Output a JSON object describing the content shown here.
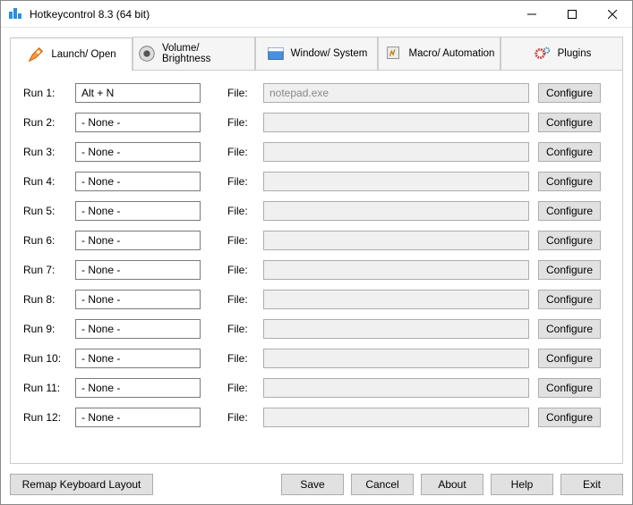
{
  "window": {
    "title": "Hotkeycontrol 8.3 (64 bit)"
  },
  "tabs": [
    {
      "label": "Launch/ Open",
      "active": true
    },
    {
      "label": "Volume/ Brightness",
      "active": false
    },
    {
      "label": "Window/ System",
      "active": false
    },
    {
      "label": "Macro/ Automation",
      "active": false
    },
    {
      "label": "Plugins",
      "active": false
    }
  ],
  "rows": [
    {
      "label": "Run 1:",
      "hotkey": "Alt + N",
      "fileLabel": "File:",
      "file": "notepad.exe",
      "cfg": "Configure"
    },
    {
      "label": "Run 2:",
      "hotkey": "- None -",
      "fileLabel": "File:",
      "file": "",
      "cfg": "Configure"
    },
    {
      "label": "Run 3:",
      "hotkey": "- None -",
      "fileLabel": "File:",
      "file": "",
      "cfg": "Configure"
    },
    {
      "label": "Run 4:",
      "hotkey": "- None -",
      "fileLabel": "File:",
      "file": "",
      "cfg": "Configure"
    },
    {
      "label": "Run 5:",
      "hotkey": "- None -",
      "fileLabel": "File:",
      "file": "",
      "cfg": "Configure"
    },
    {
      "label": "Run 6:",
      "hotkey": "- None -",
      "fileLabel": "File:",
      "file": "",
      "cfg": "Configure"
    },
    {
      "label": "Run 7:",
      "hotkey": "- None -",
      "fileLabel": "File:",
      "file": "",
      "cfg": "Configure"
    },
    {
      "label": "Run 8:",
      "hotkey": "- None -",
      "fileLabel": "File:",
      "file": "",
      "cfg": "Configure"
    },
    {
      "label": "Run 9:",
      "hotkey": "- None -",
      "fileLabel": "File:",
      "file": "",
      "cfg": "Configure"
    },
    {
      "label": "Run 10:",
      "hotkey": "- None -",
      "fileLabel": "File:",
      "file": "",
      "cfg": "Configure"
    },
    {
      "label": "Run 11:",
      "hotkey": "- None -",
      "fileLabel": "File:",
      "file": "",
      "cfg": "Configure"
    },
    {
      "label": "Run 12:",
      "hotkey": "- None -",
      "fileLabel": "File:",
      "file": "",
      "cfg": "Configure"
    }
  ],
  "bottom": {
    "remap": "Remap Keyboard Layout",
    "save": "Save",
    "cancel": "Cancel",
    "about": "About",
    "help": "Help",
    "exit": "Exit"
  }
}
